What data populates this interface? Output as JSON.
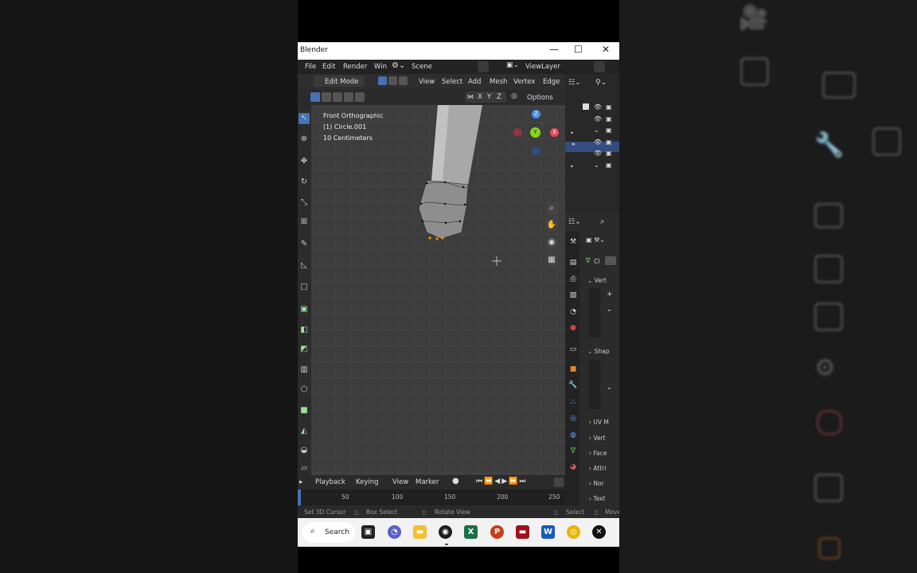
{
  "window": {
    "title": "Blender",
    "minimize": "—",
    "maximize": "☐",
    "close": "✕"
  },
  "menubar": {
    "items": [
      "File",
      "Edit",
      "Render",
      "Win"
    ],
    "scene": "Scene",
    "view_layer": "ViewLayer"
  },
  "header": {
    "mode": "Edit Mode",
    "menus": [
      "View",
      "Select",
      "Add",
      "Mesh",
      "Vertex",
      "Edge"
    ]
  },
  "header3": {
    "axes": [
      "X",
      "Y",
      "Z"
    ],
    "options": "Options"
  },
  "viewport": {
    "view_name": "Front Orthographic",
    "object": "(1) Circle.001",
    "scale": "10 Centimeters",
    "gizmo": {
      "z": "Z",
      "y": "Y",
      "x": "X"
    }
  },
  "properties": {
    "sections": [
      "Vert",
      "Shap"
    ],
    "collapsed": [
      "UV M",
      "Vert",
      "Face",
      "Attri",
      "Nor",
      "Text"
    ],
    "clip_label": "Cl"
  },
  "timeline": {
    "menus": [
      "Playback",
      "Keying",
      "View",
      "Marker"
    ],
    "ticks": [
      "50",
      "100",
      "150",
      "200",
      "250"
    ]
  },
  "statusbar": {
    "items": [
      "Set 3D Cursor",
      "Box Select",
      "Rotate View",
      "Select",
      "Move"
    ]
  },
  "taskbar": {
    "search": "Search"
  },
  "colors": {
    "accent": "#4772b3",
    "x_axis": "#e84a5f",
    "y_axis": "#8bd11a",
    "z_axis": "#4a8de8",
    "selected_vertex": "#ff8a00"
  }
}
